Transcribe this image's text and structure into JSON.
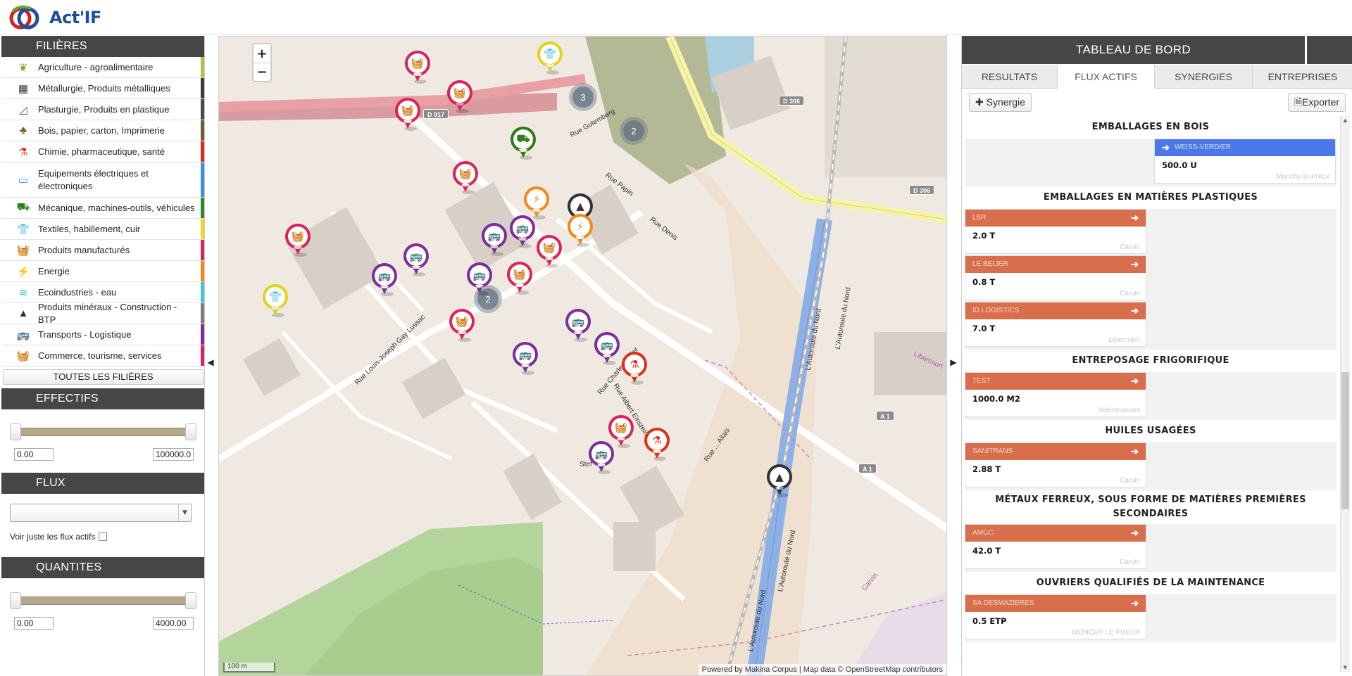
{
  "app": {
    "logo_text": "Act'IF"
  },
  "sidebar": {
    "filieres_title": "FILIÈRES",
    "filieres": [
      {
        "label": "Agriculture - agroalimentaire",
        "icon": "leaf-icon",
        "glyph": "❦",
        "icon_color": "#7fa32c",
        "bar_color": "#a4c93c"
      },
      {
        "label": "Métallurgie, Produits métalliques",
        "icon": "metal-bars-icon",
        "glyph": "▦",
        "icon_color": "#333333",
        "bar_color": "#3c3c3c"
      },
      {
        "label": "Plasturgie, Produits en plastique",
        "icon": "plastic-chart-icon",
        "glyph": "◿",
        "icon_color": "#555555",
        "bar_color": "#4a4a4a"
      },
      {
        "label": "Bois, papier, carton, Imprimerie",
        "icon": "tree-icon",
        "glyph": "♣",
        "icon_color": "#7a5a2a",
        "bar_color": "#6e5a3c"
      },
      {
        "label": "Chimie, pharmaceutique, santé",
        "icon": "flask-icon",
        "glyph": "⚗",
        "icon_color": "#d9341b",
        "bar_color": "#d92d1b"
      },
      {
        "label": "Equipements électriques et électroniques",
        "icon": "laptop-icon",
        "glyph": "▭",
        "icon_color": "#3a8fd9",
        "bar_color": "#3a8fe6"
      },
      {
        "label": "Mécanique, machines-outils, véhicules",
        "icon": "tractor-icon",
        "glyph": "⛟",
        "icon_color": "#2e7d1a",
        "bar_color": "#2e8a1e"
      },
      {
        "label": "Textiles, habillement, cuir",
        "icon": "tshirt-icon",
        "glyph": "👕",
        "icon_color": "#e5d21e",
        "bar_color": "#f0d81c"
      },
      {
        "label": "Produits manufacturés",
        "icon": "basket-icon",
        "glyph": "🧺",
        "icon_color": "#d9245a",
        "bar_color": "#d8245e"
      },
      {
        "label": "Energie",
        "icon": "lightning-icon",
        "glyph": "⚡",
        "icon_color": "#f08a1a",
        "bar_color": "#f08a1a"
      },
      {
        "label": "Ecoindustries - eau",
        "icon": "waves-icon",
        "glyph": "≋",
        "icon_color": "#3ab8c9",
        "bar_color": "#42c5d4"
      },
      {
        "label": "Produits minéraux - Construction - BTP",
        "icon": "cone-icon",
        "glyph": "▲",
        "icon_color": "#333333",
        "bar_color": "#7d7d7d"
      },
      {
        "label": "Transports - Logistique",
        "icon": "bus-icon",
        "glyph": "🚌",
        "icon_color": "#7b2e9c",
        "bar_color": "#7b2e9c"
      },
      {
        "label": "Commerce, tourisme, services",
        "icon": "basket-icon",
        "glyph": "🧺",
        "icon_color": "#d9245a",
        "bar_color": "#d8245e"
      }
    ],
    "toutes_label": "TOUTES LES FILIÈRES",
    "effectifs_title": "EFFECTIFS",
    "effectifs_min": "0.00",
    "effectifs_max": "100000.0",
    "flux_title": "FLUX",
    "flux_select_value": "",
    "flux_check_label": "Voir juste les flux actifs",
    "quantites_title": "QUANTITES",
    "quantites_min": "0.00",
    "quantites_max": "4000.00"
  },
  "map": {
    "zoom_in": "+",
    "zoom_out": "−",
    "scale_label": "100 m",
    "attribution": "Powered by Makina Corpus | Map data © OpenStreetMap contributors",
    "road_labels": [
      "Rue Gutemberg",
      "Rue Papin",
      "Rue Denis",
      "Rue Louis-Joseph Gay Lussac",
      "Rue Charles Tellier",
      "Rue Albert Einstein",
      "Stef",
      "L'Autoroute du Nord",
      "L'Autoroute du Nord",
      "L'Autoroute du Nord",
      "L'Autoroute du Nord",
      "Carvin",
      "Libercourt",
      "Rue ... Allais"
    ],
    "shields": [
      "D 917",
      "D 306",
      "D 306",
      "A 1",
      "A 1"
    ],
    "clusters": [
      "3",
      "2",
      "2"
    ]
  },
  "dashboard": {
    "title": "TABLEAU DE BORD",
    "tabs": [
      "RESULTATS",
      "FLUX ACTIFS",
      "SYNERGIES",
      "ENTREPRISES"
    ],
    "active_tab": 1,
    "synergie_label": "Synergie",
    "exporter_label": "Exporter",
    "categories": [
      {
        "title": "EMBALLAGES EN BOIS",
        "cards": [
          {
            "side": "right",
            "kind": "blue",
            "name": "WEISS-VERDIER",
            "qty": "500.0 U",
            "place": "Monchy-le-Preux"
          }
        ]
      },
      {
        "title": "EMBALLAGES EN MATIÈRES PLASTIQUES",
        "cards": [
          {
            "side": "left",
            "kind": "orange",
            "name": "LBR",
            "qty": "2.0 T",
            "place": "Carvin"
          },
          {
            "side": "left",
            "kind": "orange",
            "name": "LE BELIER",
            "qty": "0.8 T",
            "place": "Carvin"
          },
          {
            "side": "left",
            "kind": "orange",
            "name": "ID LOGISTICS",
            "qty": "7.0 T",
            "place": "Libercourt"
          }
        ]
      },
      {
        "title": "ENTREPOSAGE FRIGORIFIQUE",
        "cards": [
          {
            "side": "left",
            "kind": "orange",
            "name": "TEST",
            "qty": "1000.0 M2",
            "place": "Valenciennes"
          }
        ]
      },
      {
        "title": "HUILES USAGÉES",
        "cards": [
          {
            "side": "left",
            "kind": "orange",
            "name": "SANITRANS",
            "qty": "2.88 T",
            "place": "Carvin"
          }
        ]
      },
      {
        "title": "MÉTAUX FERREUX, SOUS FORME DE MATIÈRES PREMIÈRES SECONDAIRES",
        "cards": [
          {
            "side": "left",
            "kind": "orange",
            "name": "AMGC",
            "qty": "42.0 T",
            "place": "Carvin"
          }
        ]
      },
      {
        "title": "OUVRIERS QUALIFIÉS DE LA MAINTENANCE",
        "cards": [
          {
            "side": "left",
            "kind": "orange",
            "name": "SA DESMAZIERES",
            "qty": "0.5 ETP",
            "place": "MONCHY LE PREUX"
          }
        ]
      }
    ]
  },
  "colors": {
    "header_dark": "#464646",
    "flux_orange": "#d96e4d",
    "flux_blue": "#4a77ea",
    "slider": "#b5a98c"
  }
}
